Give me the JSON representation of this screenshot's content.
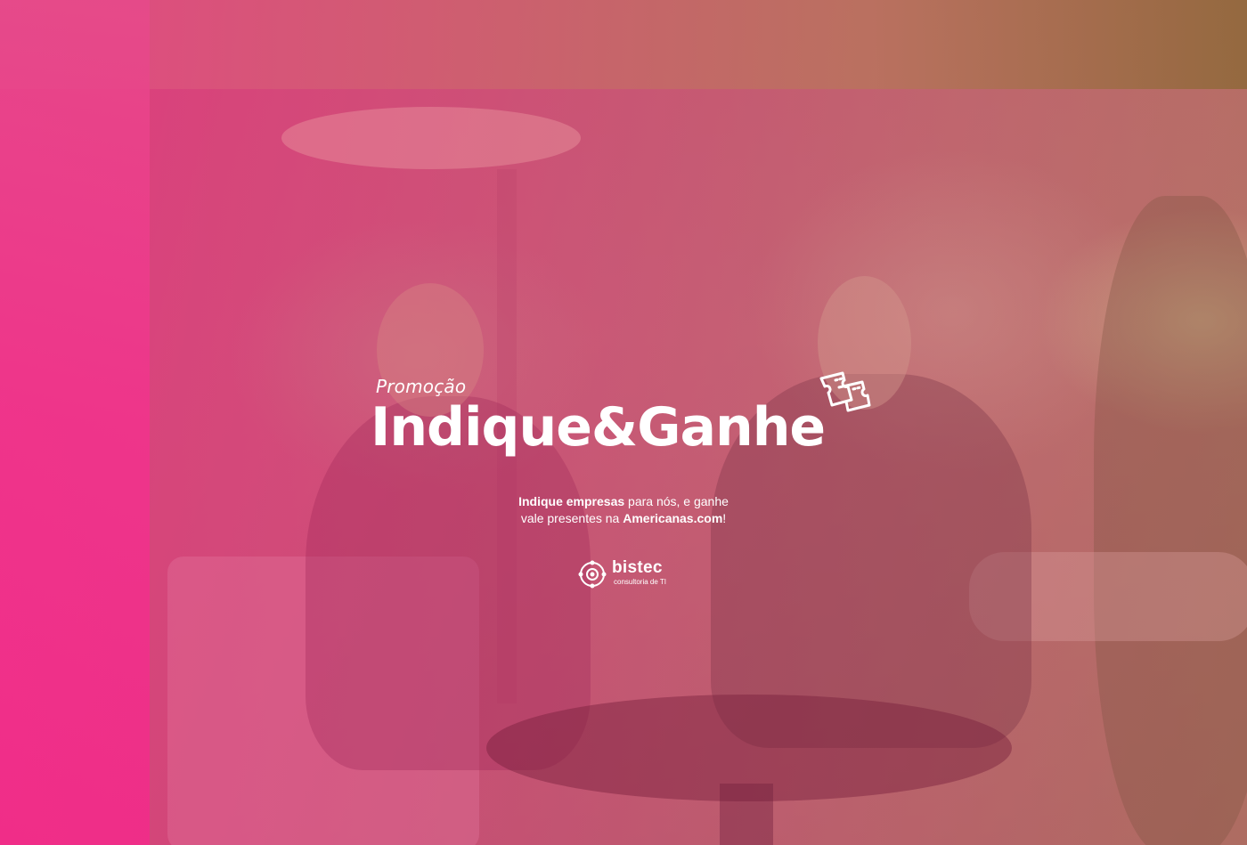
{
  "promo": {
    "label": "Promoção",
    "headline": "Indique&Ganhe"
  },
  "subtext": {
    "line1_bold": "Indique empresas",
    "line1_rest": " para nós, e ganhe",
    "line2_start": "vale presentes na ",
    "line2_bold": "Americanas.com",
    "line2_end": "!"
  },
  "logo": {
    "name": "bistec",
    "tagline": "consultoria de TI"
  },
  "colors": {
    "accent": "#f0348c",
    "text": "#ffffff"
  },
  "icons": {
    "ticket": "ticket-icon",
    "logo_mark": "bistec-logo-mark-icon"
  }
}
